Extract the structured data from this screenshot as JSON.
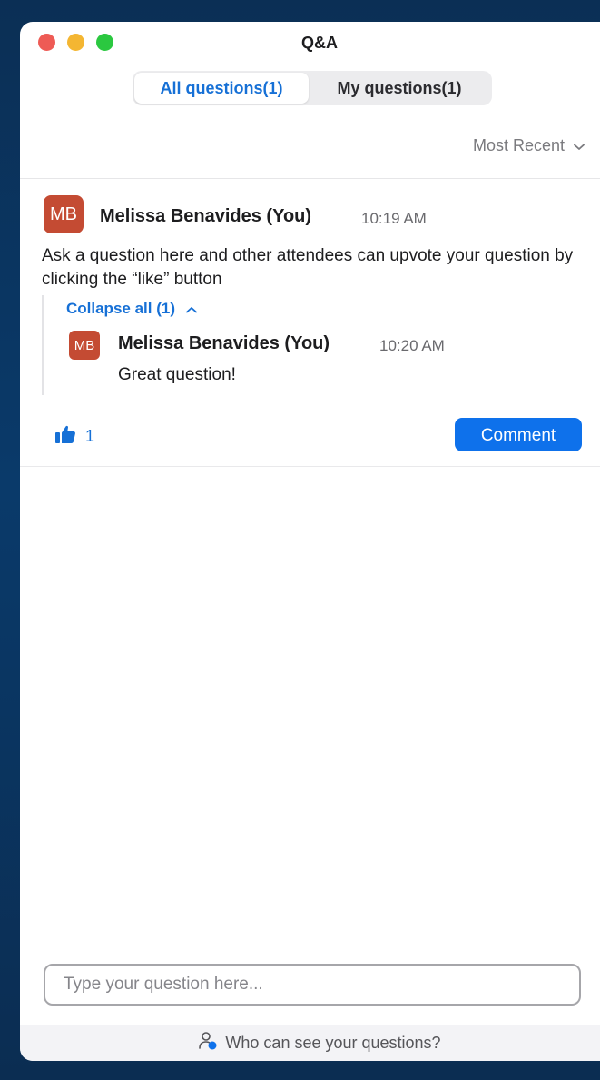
{
  "window": {
    "title": "Q&A"
  },
  "tabs": [
    {
      "label": "All questions(1)",
      "active": true
    },
    {
      "label": "My questions(1)",
      "active": false
    }
  ],
  "sort": {
    "label": "Most Recent",
    "icon": "chevron-down-icon"
  },
  "question": {
    "avatar_initials": "MB",
    "author": "Melissa Benavides (You)",
    "time": "10:19 AM",
    "text": "Ask a question here and other attendees can upvote your question by clicking the “like” button",
    "collapse_label": "Collapse all (1)",
    "reply": {
      "avatar_initials": "MB",
      "author": "Melissa Benavides (You)",
      "time": "10:20 AM",
      "text": "Great question!"
    },
    "likes": "1",
    "comment_label": "Comment"
  },
  "input": {
    "placeholder": "Type your question here..."
  },
  "footer": {
    "label": "Who can see your questions?"
  },
  "colors": {
    "accent": "#0e71eb",
    "avatar": "#c44b33",
    "link": "#1670d6"
  }
}
